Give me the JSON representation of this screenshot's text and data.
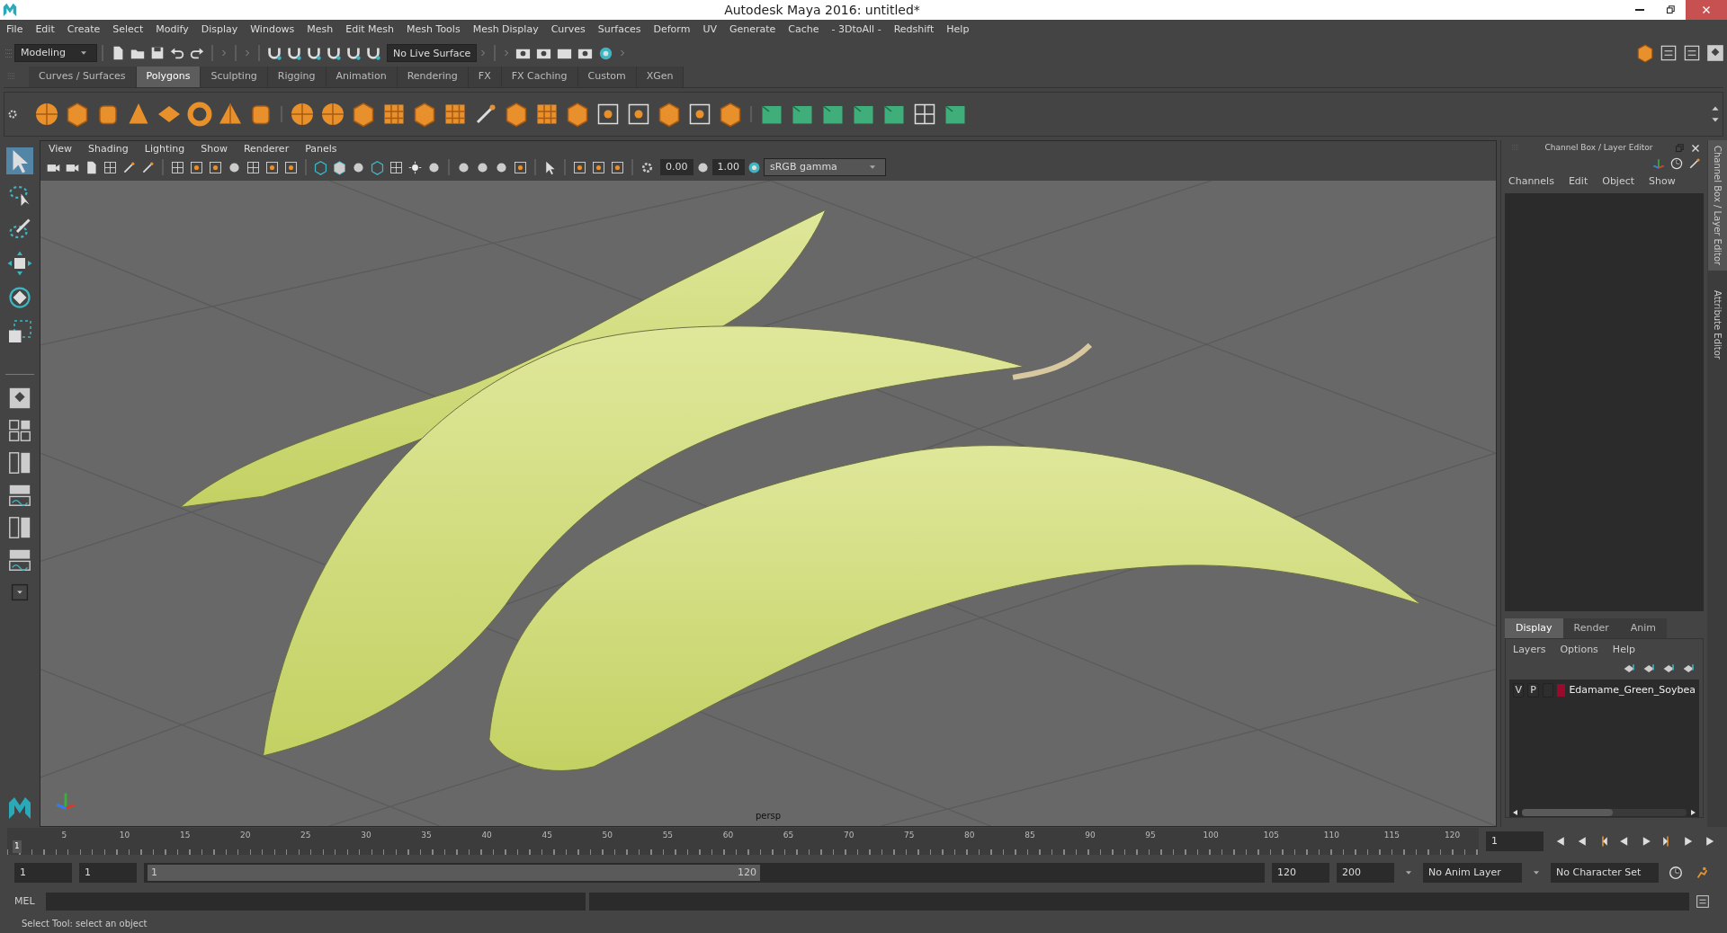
{
  "window": {
    "title": "Autodesk Maya 2016: untitled*"
  },
  "menus": [
    "File",
    "Edit",
    "Create",
    "Select",
    "Modify",
    "Display",
    "Windows",
    "Mesh",
    "Edit Mesh",
    "Mesh Tools",
    "Mesh Display",
    "Curves",
    "Surfaces",
    "Deform",
    "UV",
    "Generate",
    "Cache",
    "- 3DtoAll -",
    "Redshift",
    "Help"
  ],
  "status_line": {
    "mode": "Modeling",
    "live_surface": "No Live Surface"
  },
  "shelf_tabs": [
    {
      "label": "Curves / Surfaces",
      "selected": false
    },
    {
      "label": "Polygons",
      "selected": true
    },
    {
      "label": "Sculpting",
      "selected": false
    },
    {
      "label": "Rigging",
      "selected": false
    },
    {
      "label": "Animation",
      "selected": false
    },
    {
      "label": "Rendering",
      "selected": false
    },
    {
      "label": "FX",
      "selected": false
    },
    {
      "label": "FX Caching",
      "selected": false
    },
    {
      "label": "Custom",
      "selected": false
    },
    {
      "label": "XGen",
      "selected": false
    }
  ],
  "panel_menus": [
    "View",
    "Shading",
    "Lighting",
    "Show",
    "Renderer",
    "Panels"
  ],
  "viewport_toolbar": {
    "exposure": "0.00",
    "gamma": "1.00",
    "color_space": "sRGB gamma"
  },
  "viewport": {
    "camera": "persp"
  },
  "channel_box": {
    "title": "Channel Box / Layer Editor",
    "menus": [
      "Channels",
      "Edit",
      "Object",
      "Show"
    ]
  },
  "layer_editor": {
    "tabs": [
      {
        "label": "Display",
        "selected": true
      },
      {
        "label": "Render",
        "selected": false
      },
      {
        "label": "Anim",
        "selected": false
      }
    ],
    "menus": [
      "Layers",
      "Options",
      "Help"
    ],
    "layers": [
      {
        "visible": "V",
        "playback": "P",
        "color": "#9b0a2c",
        "name": "Edamame_Green_Soybea"
      }
    ]
  },
  "side_tabs": [
    "Channel Box / Layer Editor",
    "Attribute Editor"
  ],
  "timeline": {
    "start": "1",
    "labels": [
      "5",
      "10",
      "15",
      "20",
      "25",
      "30",
      "35",
      "40",
      "45",
      "50",
      "55",
      "60",
      "65",
      "70",
      "75",
      "80",
      "85",
      "90",
      "95",
      "100",
      "105",
      "110",
      "115",
      "120"
    ],
    "current_frame": "1"
  },
  "range": {
    "start": "1",
    "playback_start": "1",
    "slider_start": "1",
    "slider_end": "120",
    "level": 0.55,
    "playback_end": "120",
    "end": "200",
    "anim_layer": "No Anim Layer",
    "character_set": "No Character Set"
  },
  "command_line": {
    "label": "MEL"
  },
  "help_line": "Select Tool: select an object"
}
